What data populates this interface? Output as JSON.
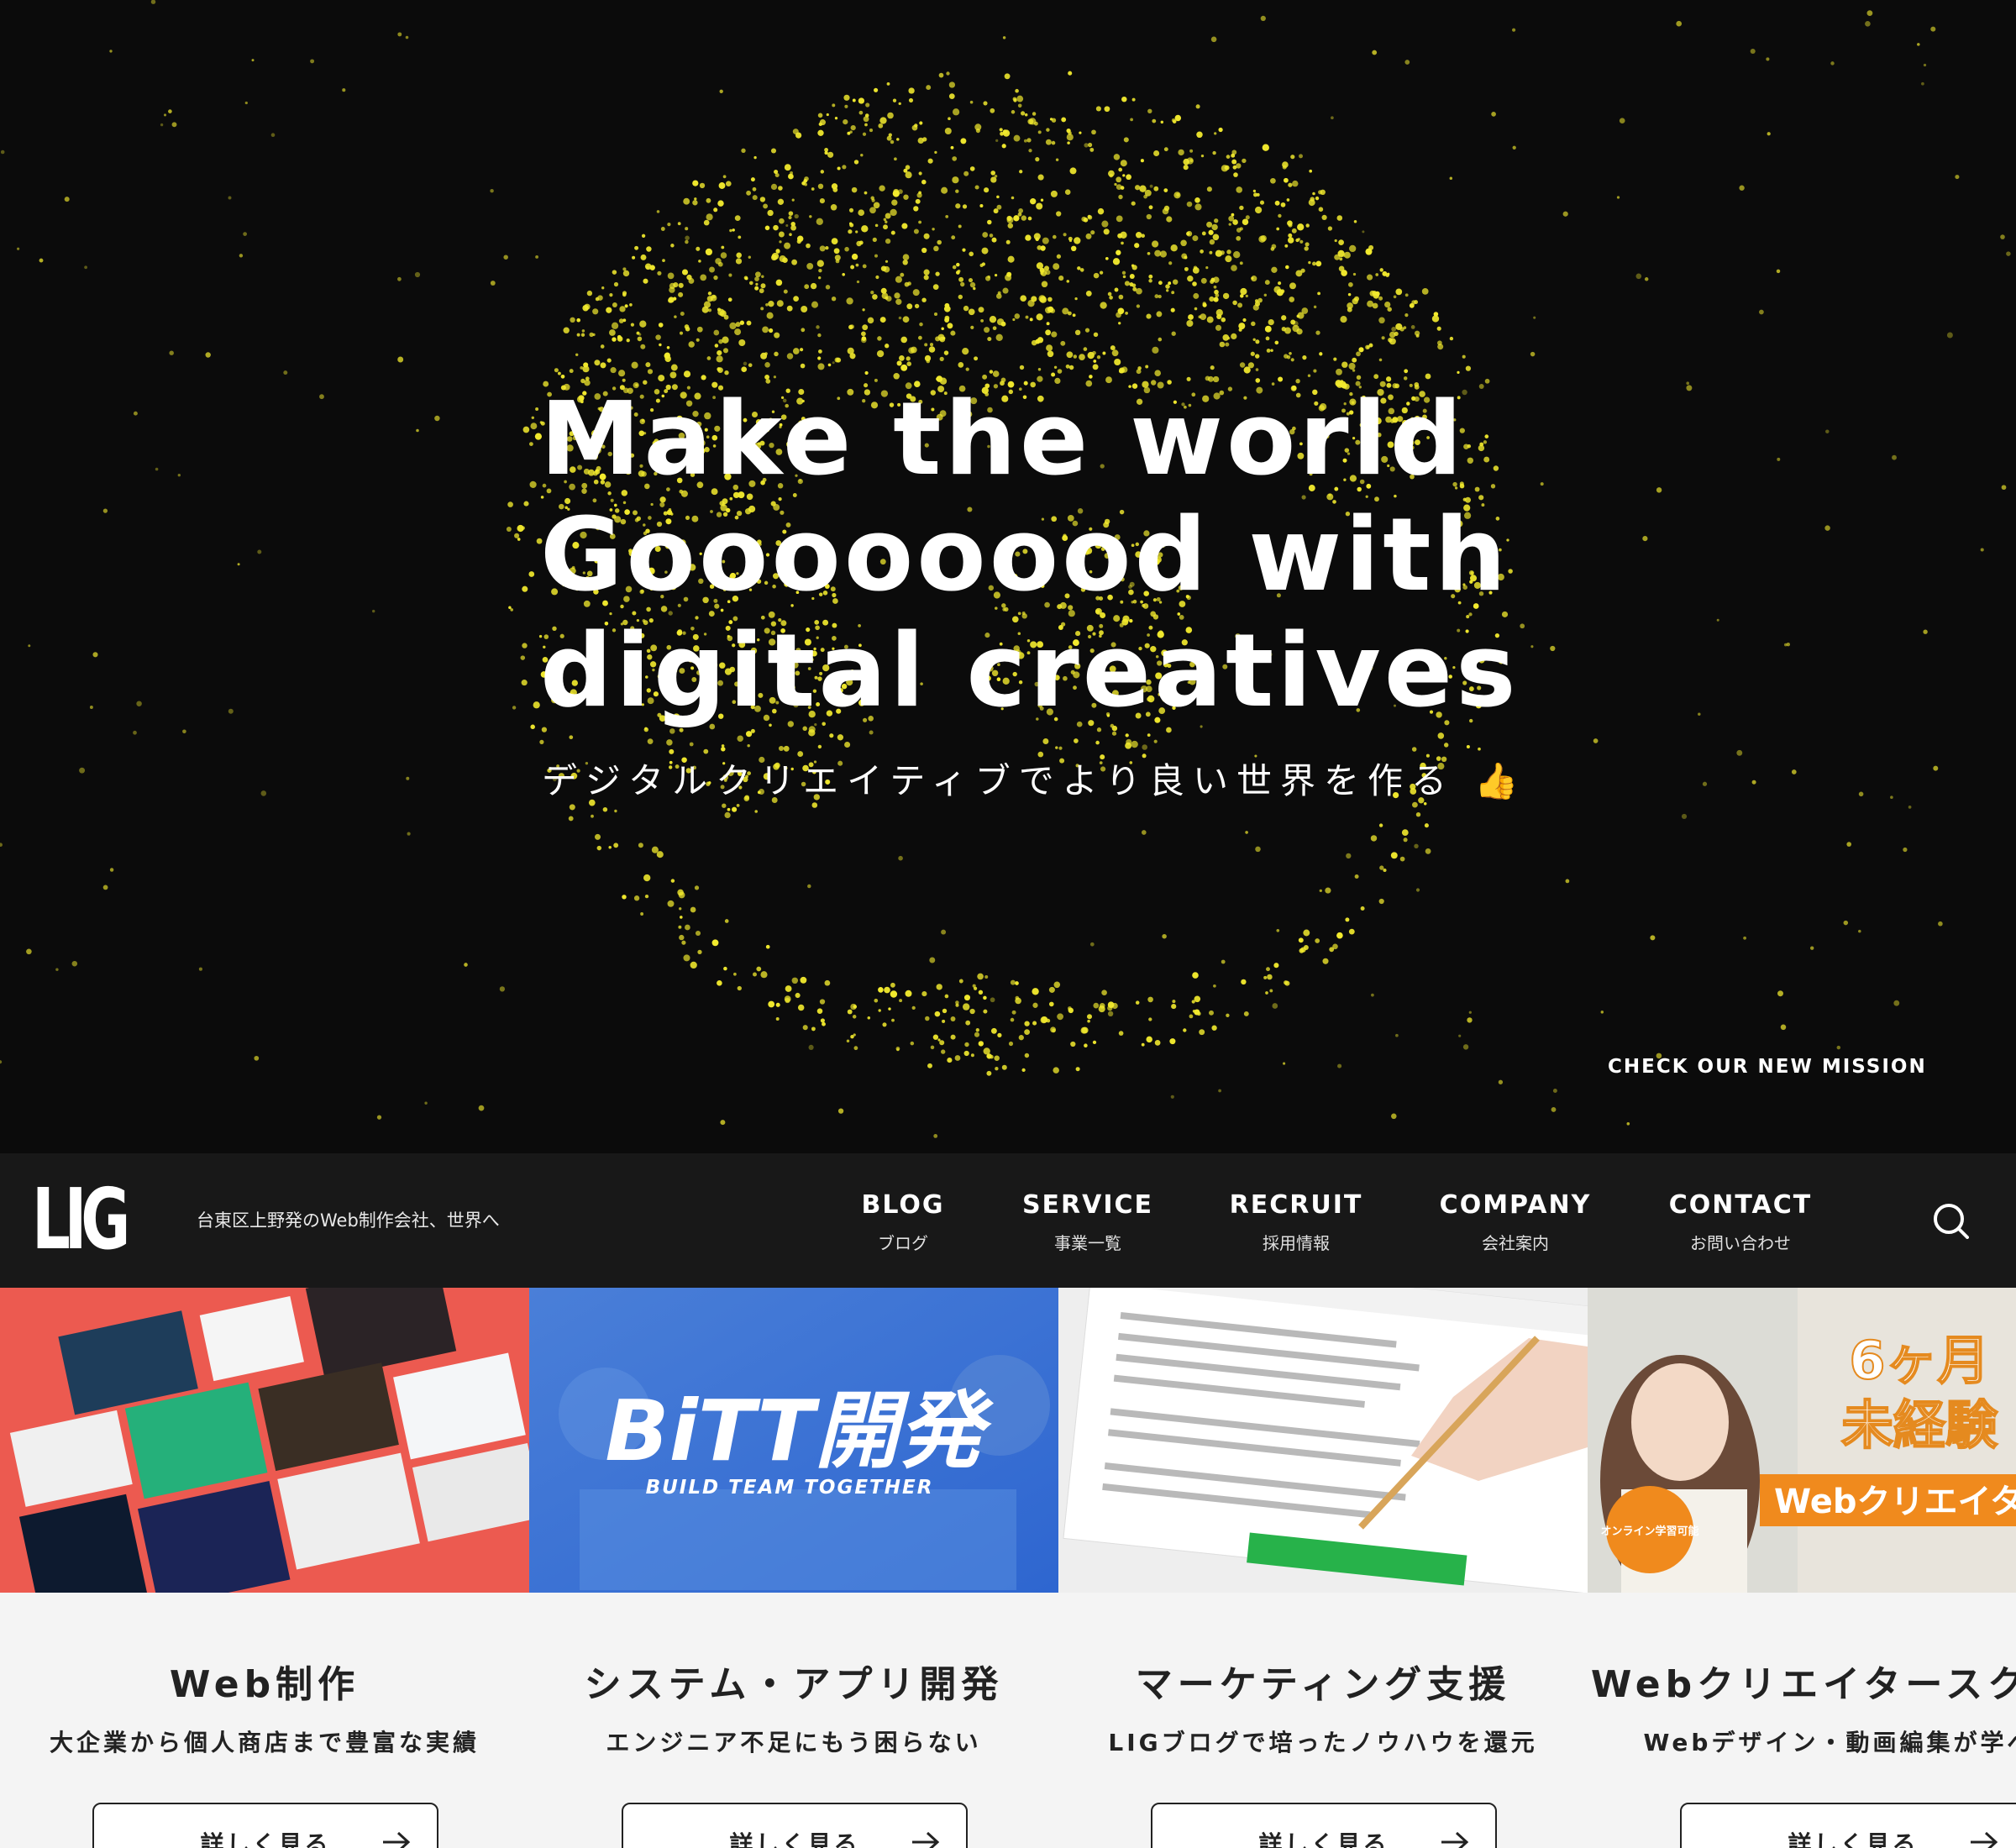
{
  "hero": {
    "headline_lines": [
      "Make the world",
      "Goooooood with",
      "digital creatives"
    ],
    "subcopy": "デジタルクリエイティブでより良い世界を作る 👍",
    "mission_link": "CHECK OUR NEW MISSION",
    "particle_color": "#f2ea2e"
  },
  "header": {
    "logo": "LIG",
    "tagline": "台東区上野発のWeb制作会社、世界へ",
    "nav": [
      {
        "en": "BLOG",
        "ja": "ブログ"
      },
      {
        "en": "SERVICE",
        "ja": "事業一覧"
      },
      {
        "en": "RECRUIT",
        "ja": "採用情報"
      },
      {
        "en": "COMPANY",
        "ja": "会社案内"
      },
      {
        "en": "CONTACT",
        "ja": "お問い合わせ"
      }
    ],
    "search_icon": "search-icon"
  },
  "services": [
    {
      "title": "Web制作",
      "desc": "大企業から個人商店まで豊富な実績",
      "button": "詳しく見る"
    },
    {
      "title": "システム・アプリ開発",
      "desc": "エンジニア不足にもう困らない",
      "button": "詳しく見る",
      "image_text": "BiTT開発",
      "image_sub": "BUILD TEAM TOGETHER"
    },
    {
      "title": "マーケティング支援",
      "desc": "LIGブログで培ったノウハウを還元",
      "button": "詳しく見る"
    },
    {
      "title": "Webクリエイタースクール",
      "desc": "Webデザイン・動画編集が学べる",
      "button": "詳しく見る",
      "image_text_1": "6ヶ月",
      "image_text_2": "未経験",
      "image_text_3": "Webクリエイター",
      "image_badge": "オンライン学習可能"
    }
  ]
}
